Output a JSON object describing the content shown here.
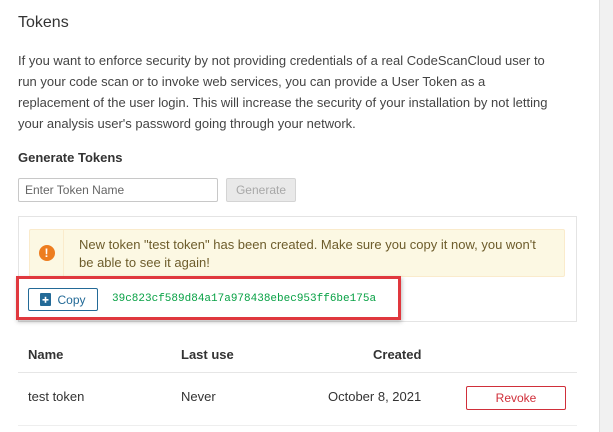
{
  "page": {
    "title": "Tokens",
    "description": "If you want to enforce security by not providing credentials of a real CodeScanCloud user to run your code scan or to invoke web services, you can provide a User Token as a replacement of the user login. This will increase the security of your installation by not letting your analysis user's password going through your network."
  },
  "generate": {
    "section_title": "Generate Tokens",
    "input_placeholder": "Enter Token Name",
    "input_value": "",
    "button_label": "Generate"
  },
  "alert": {
    "icon": "exclamation-circle-icon",
    "message": "New token \"test token\" has been created. Make sure you copy it now, you won't be able to see it again!",
    "icon_color": "#ed7d20",
    "background": "#fcf8e3"
  },
  "new_token": {
    "copy_label": "Copy",
    "value": "39c823cf589d84a17a978438ebec953ff6be175a",
    "value_color": "#08a145",
    "highlight_color": "#e0383e"
  },
  "table": {
    "columns": [
      "Name",
      "Last use",
      "Created"
    ],
    "rows": [
      {
        "name": "test token",
        "last_use": "Never",
        "created": "October 8, 2021",
        "action": "Revoke"
      }
    ]
  }
}
